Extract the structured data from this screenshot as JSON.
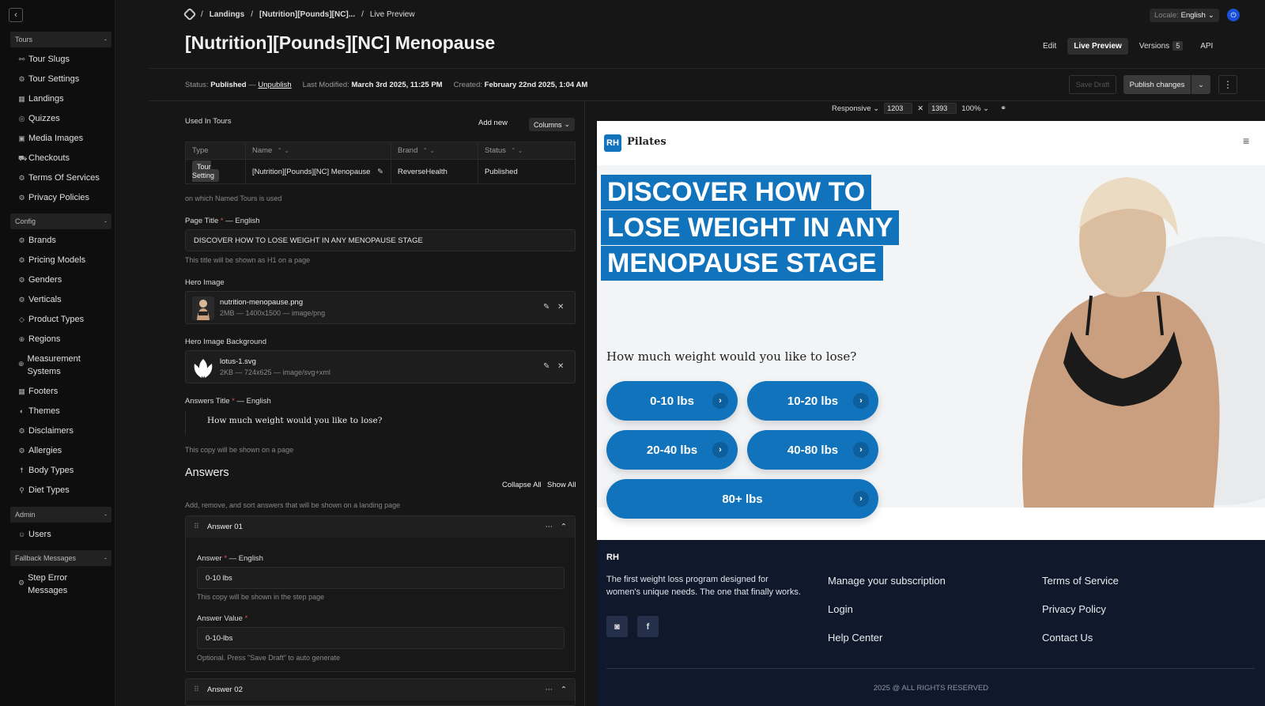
{
  "sidebar": {
    "back_icon": "chevron-left-icon",
    "groups": [
      {
        "title": "Tours",
        "toggle": "-",
        "items": [
          "Tour Slugs",
          "Tour Settings",
          "Landings",
          "Quizzes",
          "Media Images",
          "Checkouts",
          "Terms Of Services",
          "Privacy Policies"
        ]
      },
      {
        "title": "Config",
        "toggle": "-",
        "items": [
          "Brands",
          "Pricing Models",
          "Genders",
          "Verticals",
          "Product Types",
          "Regions",
          "Measurement Systems",
          "Footers",
          "Themes",
          "Disclaimers",
          "Allergies",
          "Body Types",
          "Diet Types"
        ]
      },
      {
        "title": "Admin",
        "toggle": "-",
        "items": [
          "Users"
        ]
      },
      {
        "title": "Fallback Messages",
        "toggle": "-",
        "items": [
          "Step Error Messages"
        ]
      }
    ]
  },
  "breadcrumb": {
    "sep": "/",
    "items": [
      "Landings",
      "[Nutrition][Pounds][NC]...",
      "Live Preview"
    ]
  },
  "header": {
    "title": "[Nutrition][Pounds][NC] Menopause",
    "locale_label": "Locale:",
    "locale_value": "English",
    "tabs": {
      "edit": "Edit",
      "live": "Live Preview",
      "versions": "Versions",
      "versions_count": "5",
      "api": "API"
    }
  },
  "status": {
    "status_label": "Status:",
    "status_value": "Published",
    "dash": "—",
    "unpublish": "Unpublish",
    "modified_label": "Last Modified:",
    "modified_value": "March 3rd 2025, 11:25 PM",
    "created_label": "Created:",
    "created_value": "February 22nd 2025, 1:04 AM",
    "save_draft": "Save Draft",
    "publish": "Publish changes"
  },
  "editor": {
    "used_in_tours": "Used In Tours",
    "add_new": "Add new",
    "columns": "Columns",
    "table": {
      "headers": [
        "Type",
        "Name",
        "Brand",
        "Status"
      ],
      "rows": [
        {
          "type": "Tour Setting",
          "name": "[Nutrition][Pounds][NC] Menopause",
          "brand": "ReverseHealth",
          "status": "Published"
        }
      ]
    },
    "tours_help": "on which Named Tours is used",
    "page_title_label": "Page Title",
    "lang_suffix": "— English",
    "page_title_value": "DISCOVER HOW TO LOSE WEIGHT IN ANY MENOPAUSE STAGE",
    "page_title_help": "This title will be shown as H1 on a page",
    "hero_image_label": "Hero Image",
    "hero_image": {
      "name": "nutrition-menopause.png",
      "meta": "2MB — 1400x1500 — image/png"
    },
    "hero_bg_label": "Hero Image Background",
    "hero_bg": {
      "name": "lotus-1.svg",
      "meta": "2KB — 724x625 — image/svg+xml"
    },
    "answers_title_label": "Answers Title",
    "answers_title_value": "How much weight would you like to lose?",
    "answers_title_help": "This copy will be shown on a page",
    "answers_heading": "Answers",
    "collapse_all": "Collapse All",
    "show_all": "Show All",
    "answers_help": "Add, remove, and sort answers that will be shown on a landing page",
    "answer1": {
      "title": "Answer 01",
      "answer_label": "Answer",
      "answer_value": "0-10 lbs",
      "answer_help": "This copy will be shown in the step page",
      "value_label": "Answer Value",
      "value_value": "0-10-lbs",
      "value_help": "Optional. Press \"Save Draft\" to auto generate"
    },
    "answer2": {
      "title": "Answer 02"
    }
  },
  "preview_bar": {
    "mode": "Responsive",
    "width": "1203",
    "height": "1393",
    "zoom": "100%"
  },
  "preview": {
    "logo": "RH",
    "brand": "Pilates",
    "headline": [
      "DISCOVER HOW TO",
      "LOSE WEIGHT IN ANY",
      "MENOPAUSE STAGE"
    ],
    "question": "How much weight would you like to lose?",
    "answers": [
      "0-10 lbs",
      "10-20 lbs",
      "20-40 lbs",
      "40-80 lbs",
      "80+ lbs"
    ],
    "footer": {
      "logo": "RH",
      "desc": "The first weight loss program designed for women's unique needs. The one that finally works.",
      "links_col1": [
        "Manage your subscription",
        "Login",
        "Help Center"
      ],
      "links_col2": [
        "Terms of Service",
        "Privacy Policy",
        "Contact Us"
      ],
      "copyright": "2025 @ ALL RIGHTS RESERVED"
    }
  },
  "colors": {
    "accent": "#1173bb",
    "footer_bg": "#10182b",
    "sidebar_bg": "#0e0e0e"
  }
}
